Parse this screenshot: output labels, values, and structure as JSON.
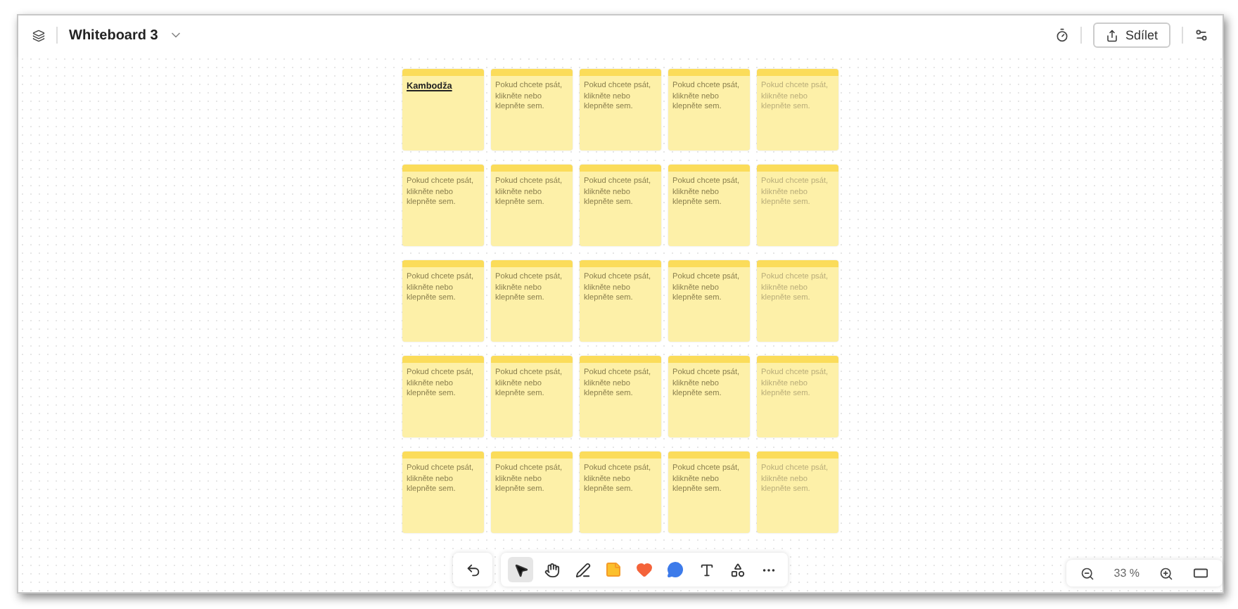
{
  "header": {
    "title": "Whiteboard 3",
    "share_label": "Sdílet"
  },
  "notes": [
    [
      {
        "text": "Kambodža",
        "kind": "title",
        "dimmed": false
      },
      {
        "text": "Pokud chcete psát, klikněte nebo klepněte sem.",
        "kind": "placeholder",
        "dimmed": false
      },
      {
        "text": "Pokud chcete psát, klikněte nebo klepněte sem.",
        "kind": "placeholder",
        "dimmed": false
      },
      {
        "text": "Pokud chcete psát, klikněte nebo klepněte sem.",
        "kind": "placeholder",
        "dimmed": false
      },
      {
        "text": "Pokud chcete psát, klikněte nebo klepněte sem.",
        "kind": "placeholder",
        "dimmed": true
      }
    ],
    [
      {
        "text": "Pokud chcete psát, klikněte nebo klepněte sem.",
        "kind": "placeholder",
        "dimmed": false
      },
      {
        "text": "Pokud chcete psát, klikněte nebo klepněte sem.",
        "kind": "placeholder",
        "dimmed": false
      },
      {
        "text": "Pokud chcete psát, klikněte nebo klepněte sem.",
        "kind": "placeholder",
        "dimmed": false
      },
      {
        "text": "Pokud chcete psát, klikněte nebo klepněte sem.",
        "kind": "placeholder",
        "dimmed": false
      },
      {
        "text": "Pokud chcete psát, klikněte nebo klepněte sem.",
        "kind": "placeholder",
        "dimmed": true
      }
    ],
    [
      {
        "text": "Pokud chcete psát, klikněte nebo klepněte sem.",
        "kind": "placeholder",
        "dimmed": false
      },
      {
        "text": "Pokud chcete psát, klikněte nebo klepněte sem.",
        "kind": "placeholder",
        "dimmed": false
      },
      {
        "text": "Pokud chcete psát, klikněte nebo klepněte sem.",
        "kind": "placeholder",
        "dimmed": false
      },
      {
        "text": "Pokud chcete psát, klikněte nebo klepněte sem.",
        "kind": "placeholder",
        "dimmed": false
      },
      {
        "text": "Pokud chcete psát, klikněte nebo klepněte sem.",
        "kind": "placeholder",
        "dimmed": true
      }
    ],
    [
      {
        "text": "Pokud chcete psát, klikněte nebo klepněte sem.",
        "kind": "placeholder",
        "dimmed": false
      },
      {
        "text": "Pokud chcete psát, klikněte nebo klepněte sem.",
        "kind": "placeholder",
        "dimmed": false
      },
      {
        "text": "Pokud chcete psát, klikněte nebo klepněte sem.",
        "kind": "placeholder",
        "dimmed": false
      },
      {
        "text": "Pokud chcete psát, klikněte nebo klepněte sem.",
        "kind": "placeholder",
        "dimmed": false
      },
      {
        "text": "Pokud chcete psát, klikněte nebo klepněte sem.",
        "kind": "placeholder",
        "dimmed": true
      }
    ],
    [
      {
        "text": "Pokud chcete psát, klikněte nebo klepněte sem.",
        "kind": "placeholder",
        "dimmed": false
      },
      {
        "text": "Pokud chcete psát, klikněte nebo klepněte sem.",
        "kind": "placeholder",
        "dimmed": false
      },
      {
        "text": "Pokud chcete psát, klikněte nebo klepněte sem.",
        "kind": "placeholder",
        "dimmed": false
      },
      {
        "text": "Pokud chcete psát, klikněte nebo klepněte sem.",
        "kind": "placeholder",
        "dimmed": false
      },
      {
        "text": "Pokud chcete psát, klikněte nebo klepněte sem.",
        "kind": "placeholder",
        "dimmed": true
      }
    ]
  ],
  "tools": [
    {
      "kind": "select",
      "selected": true
    },
    {
      "kind": "hand",
      "selected": false
    },
    {
      "kind": "pen",
      "selected": false
    },
    {
      "kind": "sticky",
      "selected": false
    },
    {
      "kind": "heart",
      "selected": false
    },
    {
      "kind": "bubble",
      "selected": false
    },
    {
      "kind": "text",
      "selected": false
    },
    {
      "kind": "shapes",
      "selected": false
    },
    {
      "kind": "more",
      "selected": false
    }
  ],
  "zoom": {
    "value": "33 %"
  }
}
